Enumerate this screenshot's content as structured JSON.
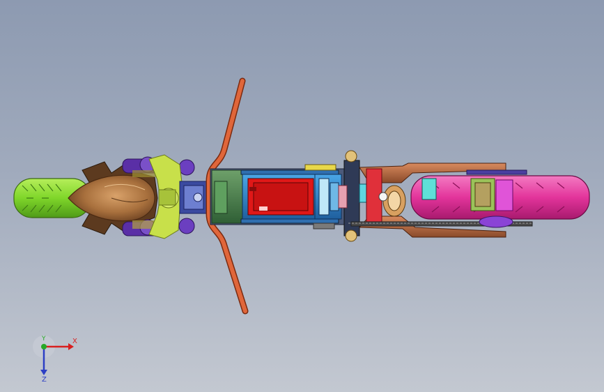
{
  "viewport": {
    "background_top": "#8d9ab1",
    "background_bottom": "#c3c8d1"
  },
  "triad": {
    "x_label": "X",
    "y_label": "Y",
    "z_label": "Z",
    "x_color": "#d81f1f",
    "y_color": "#27a827",
    "z_color": "#2c3fc4"
  },
  "parts": {
    "front_tire_color": "#7fd62a",
    "fork_body_color": "#a8703d",
    "handlebar_color": "#e0663a",
    "deck_color": "#3f7a45",
    "battery_color": "#e01818",
    "controller_color": "#2a7ec8",
    "swingarm_color": "#b0603a",
    "rear_tire_color": "#e3349b",
    "sprocket_color": "#8a44d6"
  }
}
